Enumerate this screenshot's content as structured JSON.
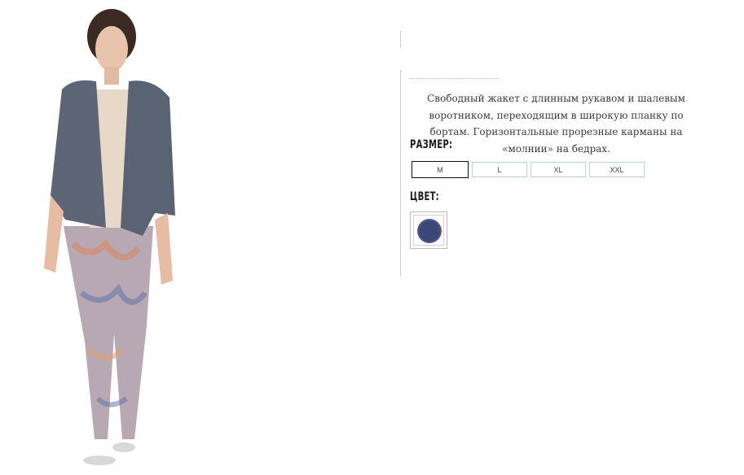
{
  "product": {
    "image_alt": "model-wearing-jacket-and-floral-pants",
    "description": "Свободный жакет с длинным рукавом и шалевым воротником, переходящим в широкую планку по бортам. Горизонтальные прорезные карманы на «молнии» на бедрах.",
    "size_label": "РАЗМЕР:",
    "sizes": [
      {
        "label": "M",
        "selected": true
      },
      {
        "label": "L",
        "selected": false
      },
      {
        "label": "XL",
        "selected": false
      },
      {
        "label": "XXL",
        "selected": false
      }
    ],
    "color_label": "ЦВЕТ:",
    "colors": [
      {
        "name": "navy",
        "hex": "#3b4776"
      }
    ]
  },
  "palette": {
    "size_border": "#b9cfd9",
    "selected_border": "#111111",
    "divider": "#cfcfcf"
  }
}
